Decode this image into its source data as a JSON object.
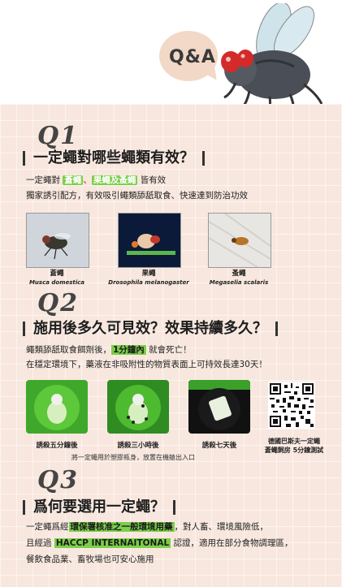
{
  "header": {
    "qa_label": "Q&A"
  },
  "q1": {
    "number": "Q1",
    "title": "一定蠅對哪些蠅類有效？",
    "line1_prefix": "一定蠅對",
    "line1_hl1": "蒼蠅",
    "line1_sep": "、",
    "line1_hl2": "果蠅及蚤蠅",
    "line1_suffix": "皆有效",
    "line2": "獨家誘引配方，有效吸引蠅類舔舐取食、快速達到防治功效",
    "flies": [
      {
        "name": "蒼蠅",
        "latin": "Musca domestica"
      },
      {
        "name": "果蠅",
        "latin": "Drosophila melanogaster"
      },
      {
        "name": "蚤蠅",
        "latin": "Megaselia scalaris"
      }
    ]
  },
  "q2": {
    "number": "Q2",
    "title": "施用後多久可見效？效果持續多久？",
    "line1_prefix": "蠅類舔舐取食餌劑後，",
    "line1_hl": "1分鐘內",
    "line1_suffix": "就會死亡！",
    "line2": "在穩定環境下，藥液在非吸附性的物質表面上可持效長達30天！",
    "traps": [
      {
        "caption": "誘殺五分鐘後"
      },
      {
        "caption": "誘殺三小時後"
      },
      {
        "caption": "誘殺七天後"
      }
    ],
    "qr_caption1": "德國巴斯夫一定蠅",
    "qr_caption2": "蒼蠅飼房 5分鐘測試",
    "note": "將一定蠅用於塑膠瓶身，放置在機艙出入口"
  },
  "q3": {
    "number": "Q3",
    "title": "爲何要選用一定蠅？",
    "line1_prefix": "一定蠅爲經",
    "line1_hl": "環保署核准之一般環境用藥",
    "line1_suffix": "，對人畜、環境風險低，",
    "line2_prefix": "且經過",
    "line2_hl": "HACCP INTERNAITONAL",
    "line2_suffix": "認證，適用在部分食物調理區，",
    "line3": "餐飲食品業、畜牧場也可安心施用"
  },
  "colors": {
    "panel": "#f8e7de",
    "highlight": "#7bcf4a",
    "fly_eye": "#d42a2a"
  }
}
